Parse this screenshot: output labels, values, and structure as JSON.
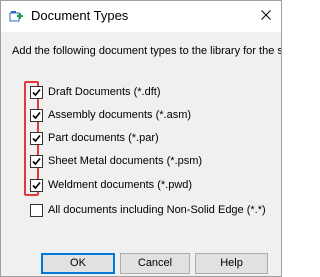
{
  "window": {
    "title": "Document Types",
    "icon": "folder-add-icon",
    "close_icon": "close-icon"
  },
  "instruction": "Add the following document types to the library for the selected folders:",
  "document_types": [
    {
      "label": "Draft Documents (*.dft)",
      "checked": true
    },
    {
      "label": "Assembly documents (*.asm)",
      "checked": true
    },
    {
      "label": "Part documents (*.par)",
      "checked": true
    },
    {
      "label": "Sheet Metal documents (*.psm)",
      "checked": true
    },
    {
      "label": "Weldment documents (*.pwd)",
      "checked": true
    }
  ],
  "all_documents": {
    "label": "All documents including Non-Solid Edge (*.*)",
    "checked": false
  },
  "buttons": {
    "ok": "OK",
    "cancel": "Cancel",
    "help": "Help"
  },
  "colors": {
    "annotation": "#e03a3a",
    "default_button_border": "#0078d7",
    "icon_green": "#1aa34a",
    "icon_blue": "#2a6ebd"
  }
}
